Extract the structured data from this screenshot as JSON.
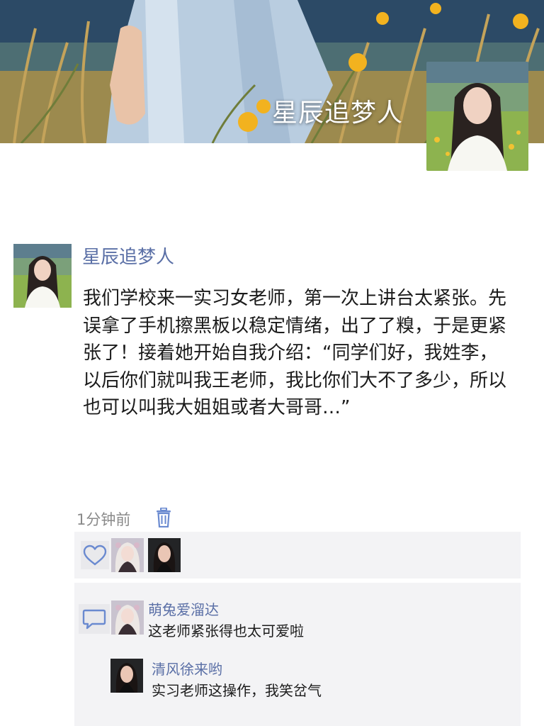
{
  "cover": {
    "username": "星辰追梦人",
    "background_icon": "field-of-grass-photo",
    "avatar_icon": "profile-photo"
  },
  "post": {
    "author": "星辰追梦人",
    "text": "我们学校来一实习女老师，第一次上讲台太紧张。先误拿了手机擦黑板以稳定情绪，出了了糗，于是更紧张了！接着她开始自我介绍：“同学们好，我姓李，以后你们就叫我王老师，我比你们大不了多少，所以也可以叫我大姐姐或者大哥哥…”",
    "time": "1分钟前",
    "delete_icon": "trash-icon"
  },
  "likes": {
    "icon": "heart-icon",
    "users": [
      "萌兔爱溜达",
      "清风徐来哟"
    ]
  },
  "comments": {
    "icon": "comment-icon",
    "items": [
      {
        "author": "萌兔爱溜达",
        "text": "这老师紧张得也太可爱啦"
      },
      {
        "author": "清风徐来哟",
        "text": "实习老师这操作，我笑岔气"
      }
    ]
  },
  "colors": {
    "link_blue": "#5a6fa6",
    "panel_bg": "#f3f3f5",
    "time_gray": "#8a8a8a"
  }
}
